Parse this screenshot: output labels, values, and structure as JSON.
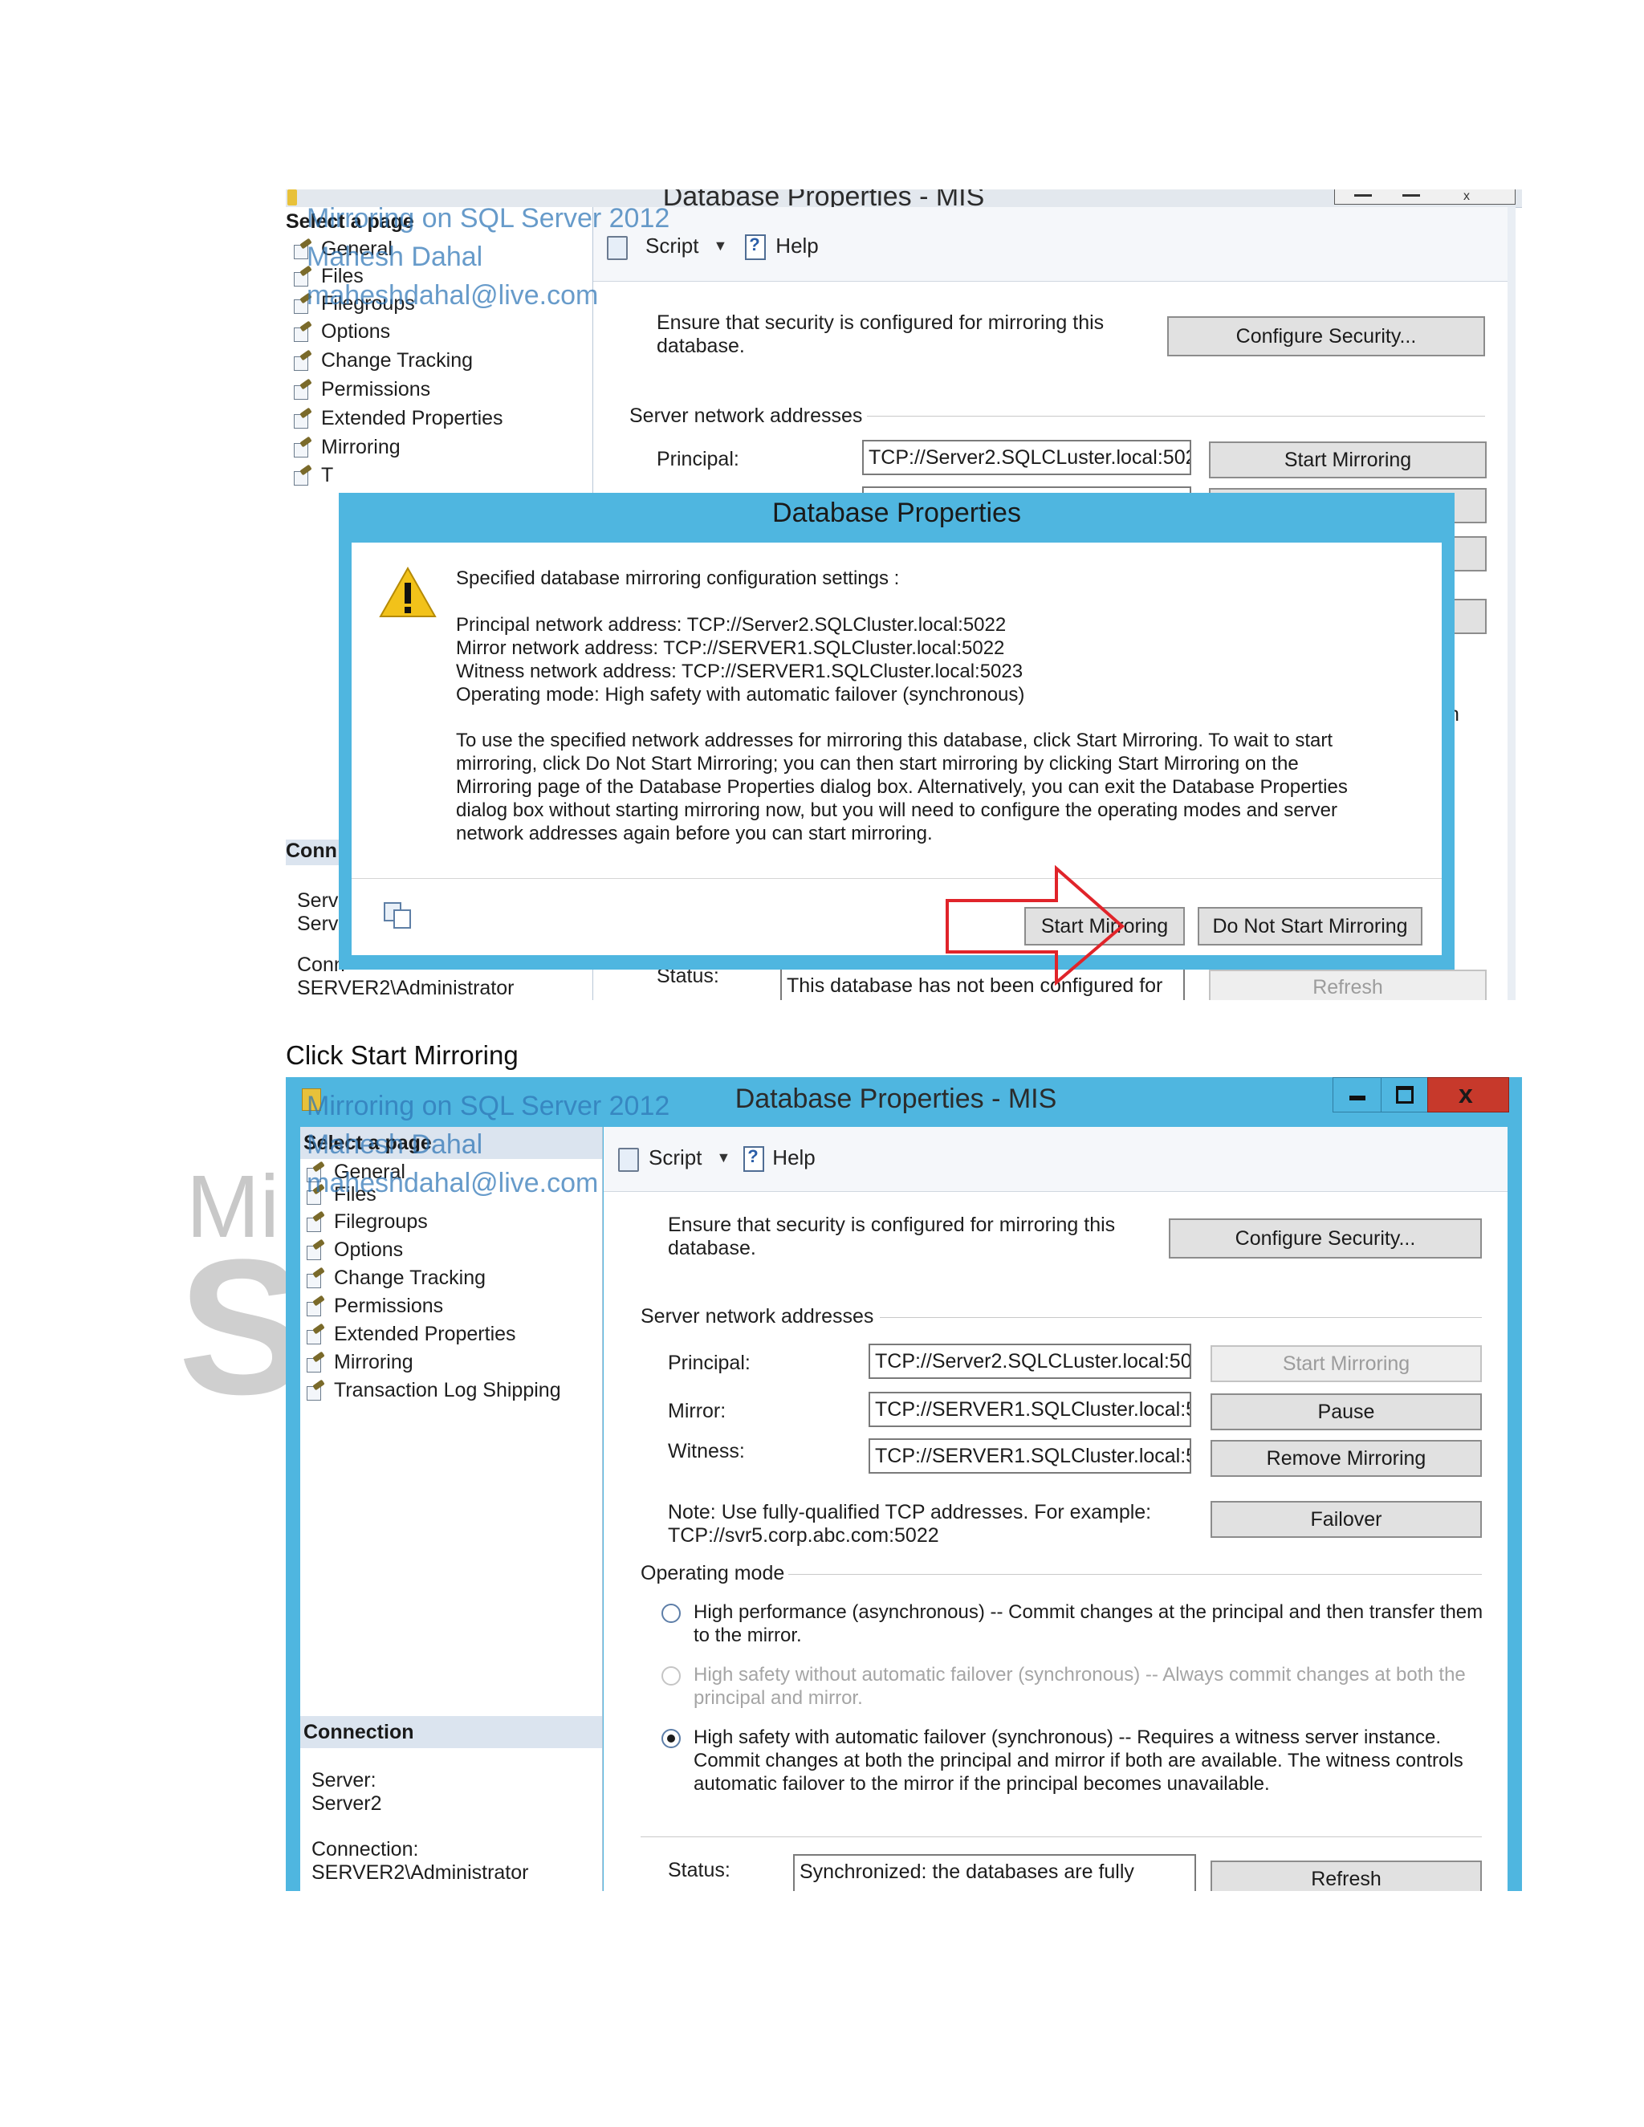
{
  "watermark": {
    "line1": "Mirroring on SQL Server 2012",
    "line2": "Mahesh Dahal",
    "line3": "maheshdahal@live.com"
  },
  "background_logo": {
    "line1": "Mi",
    "line2": "S"
  },
  "caption": "Click Start Mirroring",
  "screen1": {
    "window_title": "Database Properties - MIS",
    "select_page": "Select a page",
    "pages": [
      "General",
      "Files",
      "Filegroups",
      "Options",
      "Change Tracking",
      "Permissions",
      "Extended Properties",
      "Mirroring",
      "T"
    ],
    "connection_head": "Conn",
    "server_lines": [
      "Serve",
      "Serve"
    ],
    "conn_line": "Conn",
    "conn_user": "SERVER2\\Administrator",
    "toolbar": {
      "script": "Script",
      "help": "Help"
    },
    "security_text": "Ensure that security is configured for mirroring this\ndatabase.",
    "configure_security": "Configure Security...",
    "server_network_addresses": "Server network addresses",
    "principal_label": "Principal:",
    "principal_value": "TCP://Server2.SQLCLuster.local:502",
    "start_mirroring": "Start Mirroring",
    "status_label": "Status:",
    "status_value": "This database has not been configured for",
    "refresh": "Refresh",
    "fragment_h": "h",
    "dialog": {
      "title": "Database Properties",
      "heading": "Specified database mirroring configuration settings :",
      "lines": "Principal network address: TCP://Server2.SQLCluster.local:5022\nMirror network address: TCP://SERVER1.SQLCluster.local:5022\nWitness network address: TCP://SERVER1.SQLCluster.local:5023\nOperating mode: High safety with automatic failover (synchronous)",
      "body": "To use the specified network addresses for mirroring this database, click Start Mirroring.  To wait to start\nmirroring, click Do Not Start Mirroring; you can then start mirroring by clicking Start Mirroring on the\nMirroring page of the Database Properties dialog box. Alternatively, you can exit the Database Properties\ndialog box without starting mirroring now, but you will need to configure the operating modes and server\nnetwork addresses again before you can start mirroring.",
      "start_button": "Start Mirroring",
      "do_not_start_button": "Do Not Start Mirroring"
    }
  },
  "screen2": {
    "window_title": "Database Properties - MIS",
    "select_page": "Select a page",
    "pages": [
      "General",
      "Files",
      "Filegroups",
      "Options",
      "Change Tracking",
      "Permissions",
      "Extended Properties",
      "Mirroring",
      "Transaction Log Shipping"
    ],
    "connection_head": "Connection",
    "server_label": "Server:",
    "server_value": "Server2",
    "connection_label": "Connection:",
    "connection_value": "SERVER2\\Administrator",
    "toolbar": {
      "script": "Script",
      "help": "Help"
    },
    "security_text": "Ensure that security is configured for mirroring this\ndatabase.",
    "configure_security": "Configure Security...",
    "server_network_addresses": "Server network addresses",
    "principal_label": "Principal:",
    "principal_value": "TCP://Server2.SQLCLuster.local:502",
    "mirror_label": "Mirror:",
    "mirror_value": "TCP://SERVER1.SQLCluster.local:5",
    "witness_label": "Witness:",
    "witness_value": "TCP://SERVER1.SQLCluster.local:5",
    "start_mirroring": "Start Mirroring",
    "pause": "Pause",
    "remove_mirroring": "Remove Mirroring",
    "failover": "Failover",
    "note": "Note: Use fully-qualified TCP addresses. For example:\nTCP://svr5.corp.abc.com:5022",
    "operating_mode": "Operating mode",
    "mode_high_performance": "High performance (asynchronous) -- Commit changes at the principal and then transfer them\nto the mirror.",
    "mode_high_safety_no_failover": "High safety without automatic failover (synchronous) -- Always commit changes at both the\nprincipal and mirror.",
    "mode_high_safety_failover": "High safety with automatic failover (synchronous) -- Requires a witness server instance.\nCommit changes at both the principal and mirror if both are available. The witness controls\nautomatic failover to the mirror if the principal becomes unavailable.",
    "status_label": "Status:",
    "status_value": "Synchronized: the databases are fully",
    "refresh": "Refresh"
  },
  "colors": {
    "window_frame": "#4fb6e0",
    "close_button": "#c7392b",
    "arrow": "#e0242a",
    "watermark": "#2e75b6"
  }
}
